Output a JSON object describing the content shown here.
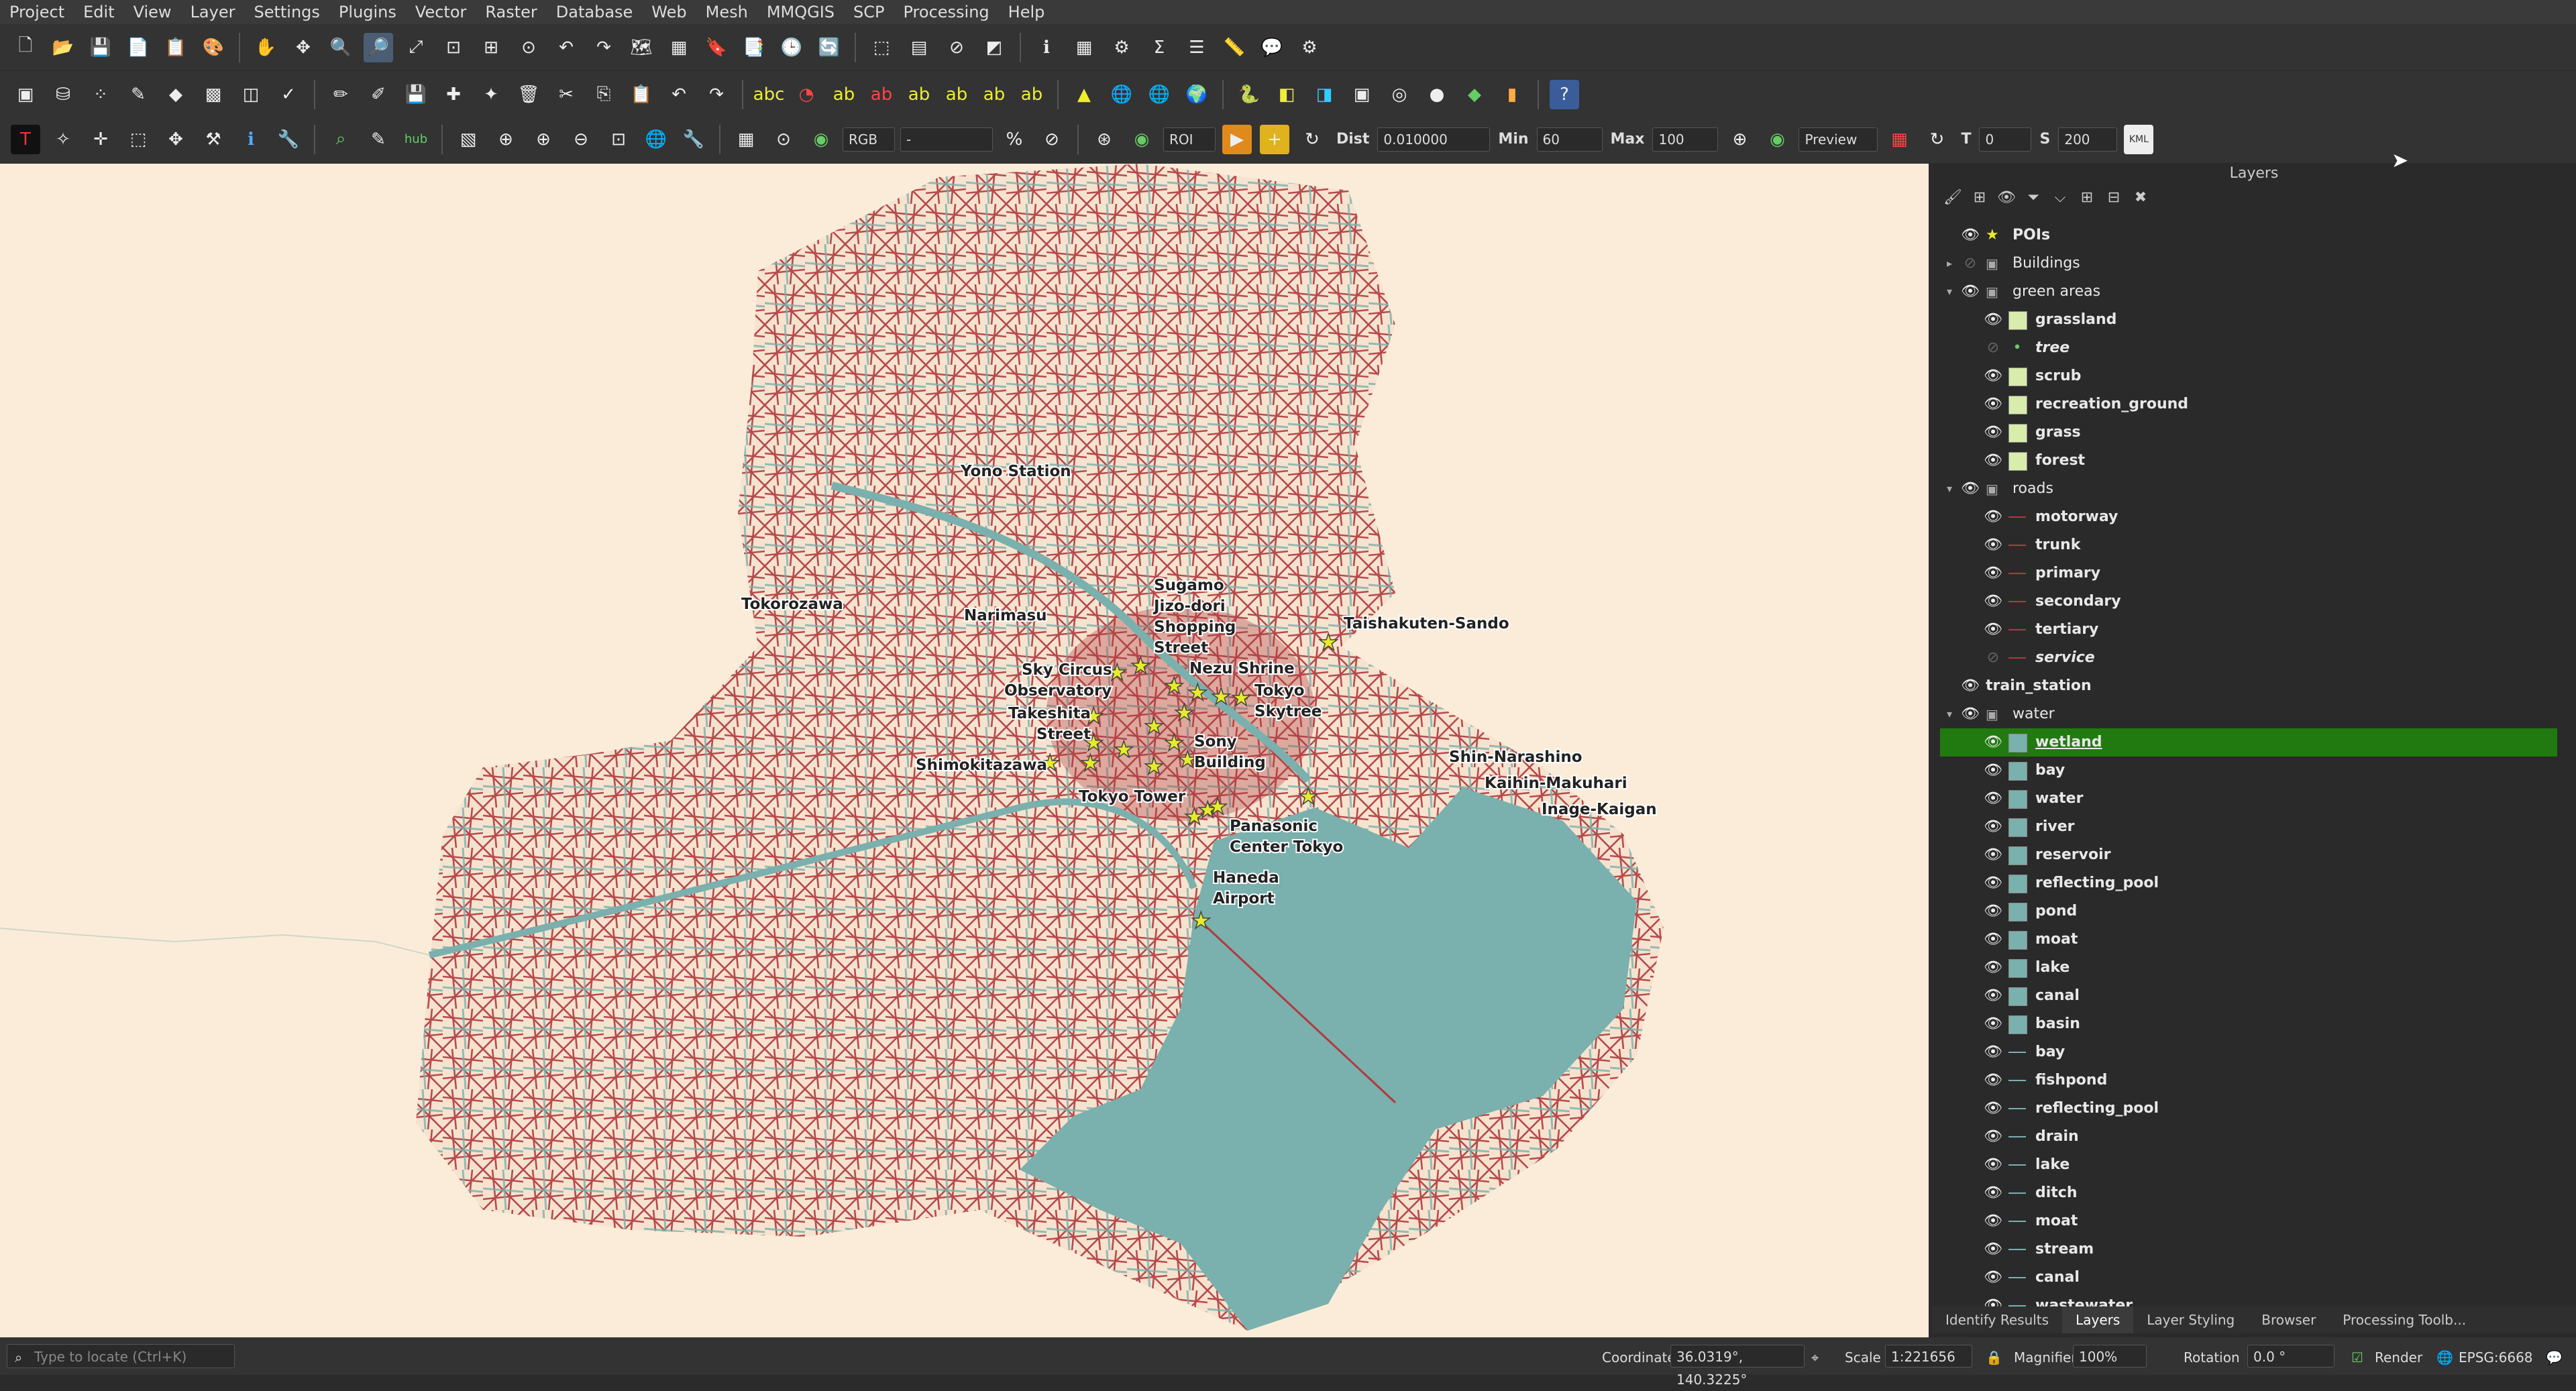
{
  "menu": [
    "Project",
    "Edit",
    "View",
    "Layer",
    "Settings",
    "Plugins",
    "Vector",
    "Raster",
    "Database",
    "Web",
    "Mesh",
    "MMQGIS",
    "SCP",
    "Processing",
    "Help"
  ],
  "toolbar3": {
    "rgb_label": "RGB",
    "band_value": "-",
    "roi_label": "ROI",
    "dist_label": "Dist",
    "dist_value": "0.010000",
    "min_label": "Min",
    "min_value": "60",
    "max_label": "Max",
    "max_value": "100",
    "preview_label": "Preview",
    "t_label": "T",
    "t_value": "0",
    "s_label": "S",
    "s_value": "200",
    "kml_label": "KML"
  },
  "panel": {
    "title": "Layers",
    "rows": [
      {
        "label": "POIs",
        "level": 0,
        "expander": "",
        "eye": "on",
        "symbol": "star",
        "style": "bold"
      },
      {
        "label": "Buildings",
        "level": 0,
        "expander": "▸",
        "eye": "off",
        "symbol": "group",
        "style": "group"
      },
      {
        "label": "green areas",
        "level": 0,
        "expander": "▾",
        "eye": "on",
        "symbol": "group",
        "style": "group"
      },
      {
        "label": "grassland",
        "level": 1,
        "expander": "",
        "eye": "on",
        "symbol": "fill-green",
        "style": "bold"
      },
      {
        "label": "tree",
        "level": 1,
        "expander": "",
        "eye": "off",
        "symbol": "dot",
        "style": "ital"
      },
      {
        "label": "scrub",
        "level": 1,
        "expander": "",
        "eye": "on",
        "symbol": "fill-green",
        "style": "bold"
      },
      {
        "label": "recreation_ground",
        "level": 1,
        "expander": "",
        "eye": "on",
        "symbol": "fill-green",
        "style": "bold"
      },
      {
        "label": "grass",
        "level": 1,
        "expander": "",
        "eye": "on",
        "symbol": "fill-green",
        "style": "bold"
      },
      {
        "label": "forest",
        "level": 1,
        "expander": "",
        "eye": "on",
        "symbol": "fill-green",
        "style": "bold"
      },
      {
        "label": "roads",
        "level": 0,
        "expander": "▾",
        "eye": "on",
        "symbol": "group",
        "style": "group"
      },
      {
        "label": "motorway",
        "level": 1,
        "expander": "",
        "eye": "on",
        "symbol": "line-red",
        "style": "bold"
      },
      {
        "label": "trunk",
        "level": 1,
        "expander": "",
        "eye": "on",
        "symbol": "line-red",
        "style": "bold"
      },
      {
        "label": "primary",
        "level": 1,
        "expander": "",
        "eye": "on",
        "symbol": "line-red",
        "style": "bold"
      },
      {
        "label": "secondary",
        "level": 1,
        "expander": "",
        "eye": "on",
        "symbol": "line-red",
        "style": "bold"
      },
      {
        "label": "tertiary",
        "level": 1,
        "expander": "",
        "eye": "on",
        "symbol": "line-red",
        "style": "bold"
      },
      {
        "label": "service",
        "level": 1,
        "expander": "",
        "eye": "off",
        "symbol": "line-red",
        "style": "ital"
      },
      {
        "label": "train_station",
        "level": 0,
        "expander": "",
        "eye": "on",
        "symbol": "none",
        "style": "bold"
      },
      {
        "label": "water",
        "level": 0,
        "expander": "▾",
        "eye": "on",
        "symbol": "group",
        "style": "group"
      },
      {
        "label": "wetland",
        "level": 1,
        "expander": "",
        "eye": "on",
        "symbol": "fill-blue",
        "style": "bold",
        "selected": true
      },
      {
        "label": "bay",
        "level": 1,
        "expander": "",
        "eye": "on",
        "symbol": "fill-blue",
        "style": "bold"
      },
      {
        "label": "water",
        "level": 1,
        "expander": "",
        "eye": "on",
        "symbol": "fill-blue",
        "style": "bold"
      },
      {
        "label": "river",
        "level": 1,
        "expander": "",
        "eye": "on",
        "symbol": "fill-blue",
        "style": "bold"
      },
      {
        "label": "reservoir",
        "level": 1,
        "expander": "",
        "eye": "on",
        "symbol": "fill-blue",
        "style": "bold"
      },
      {
        "label": "reflecting_pool",
        "level": 1,
        "expander": "",
        "eye": "on",
        "symbol": "fill-blue",
        "style": "bold"
      },
      {
        "label": "pond",
        "level": 1,
        "expander": "",
        "eye": "on",
        "symbol": "fill-blue",
        "style": "bold"
      },
      {
        "label": "moat",
        "level": 1,
        "expander": "",
        "eye": "on",
        "symbol": "fill-blue",
        "style": "bold"
      },
      {
        "label": "lake",
        "level": 1,
        "expander": "",
        "eye": "on",
        "symbol": "fill-blue",
        "style": "bold"
      },
      {
        "label": "canal",
        "level": 1,
        "expander": "",
        "eye": "on",
        "symbol": "fill-blue",
        "style": "bold"
      },
      {
        "label": "basin",
        "level": 1,
        "expander": "",
        "eye": "on",
        "symbol": "fill-blue",
        "style": "bold"
      },
      {
        "label": "bay",
        "level": 1,
        "expander": "",
        "eye": "on",
        "symbol": "line-blue",
        "style": "bold"
      },
      {
        "label": "fishpond",
        "level": 1,
        "expander": "",
        "eye": "on",
        "symbol": "line-blue",
        "style": "bold"
      },
      {
        "label": "reflecting_pool",
        "level": 1,
        "expander": "",
        "eye": "on",
        "symbol": "line-blue",
        "style": "bold"
      },
      {
        "label": "drain",
        "level": 1,
        "expander": "",
        "eye": "on",
        "symbol": "line-blue",
        "style": "bold"
      },
      {
        "label": "lake",
        "level": 1,
        "expander": "",
        "eye": "on",
        "symbol": "line-blue",
        "style": "bold"
      },
      {
        "label": "ditch",
        "level": 1,
        "expander": "",
        "eye": "on",
        "symbol": "line-blue",
        "style": "bold"
      },
      {
        "label": "moat",
        "level": 1,
        "expander": "",
        "eye": "on",
        "symbol": "line-blue",
        "style": "bold"
      },
      {
        "label": "stream",
        "level": 1,
        "expander": "",
        "eye": "on",
        "symbol": "line-blue",
        "style": "bold"
      },
      {
        "label": "canal",
        "level": 1,
        "expander": "",
        "eye": "on",
        "symbol": "line-blue",
        "style": "bold"
      },
      {
        "label": "wastewater",
        "level": 1,
        "expander": "",
        "eye": "on",
        "symbol": "line-blue",
        "style": "bold"
      }
    ],
    "tabs": [
      "Identify Results",
      "Layers",
      "Layer Styling",
      "Browser",
      "Processing Toolb..."
    ],
    "active_tab": "Layers"
  },
  "map": {
    "labels": [
      {
        "text": "Yono Station"
      },
      {
        "text": "Tokorozawa"
      },
      {
        "text": "Narimasu"
      },
      {
        "text": "Sugamo"
      },
      {
        "text": "Jizo-dori"
      },
      {
        "text": "Shopping"
      },
      {
        "text": "Street"
      },
      {
        "text": "Taishakuten-Sando"
      },
      {
        "text": "Sky Circus"
      },
      {
        "text": "Observatory"
      },
      {
        "text": "Nezu Shrine"
      },
      {
        "text": "Tokyo"
      },
      {
        "text": "Skytree"
      },
      {
        "text": "Takeshita"
      },
      {
        "text": "Street"
      },
      {
        "text": "Sony"
      },
      {
        "text": "Building"
      },
      {
        "text": "Shimokitazawa"
      },
      {
        "text": "Tokyo Tower"
      },
      {
        "text": "Shin-Narashino"
      },
      {
        "text": "Kaihin-Makuhari"
      },
      {
        "text": "Inage-Kaigan"
      },
      {
        "text": "Panasonic"
      },
      {
        "text": "Center Tokyo"
      },
      {
        "text": "Haneda"
      },
      {
        "text": "Airport"
      }
    ],
    "colors": {
      "background": "#fbecd9",
      "water": "#7ab0ad",
      "roads": "#b03a3e",
      "poi": "#e6ec2a"
    }
  },
  "status": {
    "locator_placeholder": "Type to locate (Ctrl+K)",
    "coordinate_label": "Coordinate",
    "coordinate_value": "36.0319°, 140.3225°",
    "scale_label": "Scale",
    "scale_value": "1:221656",
    "magnifier_label": "Magnifier",
    "magnifier_value": "100%",
    "rotation_label": "Rotation",
    "rotation_value": "0.0 °",
    "render_label": "Render",
    "crs_label": "EPSG:6668"
  }
}
